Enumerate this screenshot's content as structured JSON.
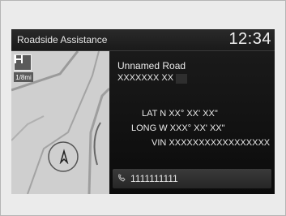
{
  "header": {
    "title": "Roadside Assistance",
    "time": "12:34"
  },
  "map": {
    "scale_label": "1/8mi"
  },
  "location": {
    "road": "Unnamed Road",
    "postal": "XXXXXXX XX",
    "lat": "LAT N XX° XX' XX\"",
    "long": "LONG W XXX° XX' XX\"",
    "vin": "VIN XXXXXXXXXXXXXXXXX"
  },
  "phone": {
    "number": "1111111111"
  }
}
